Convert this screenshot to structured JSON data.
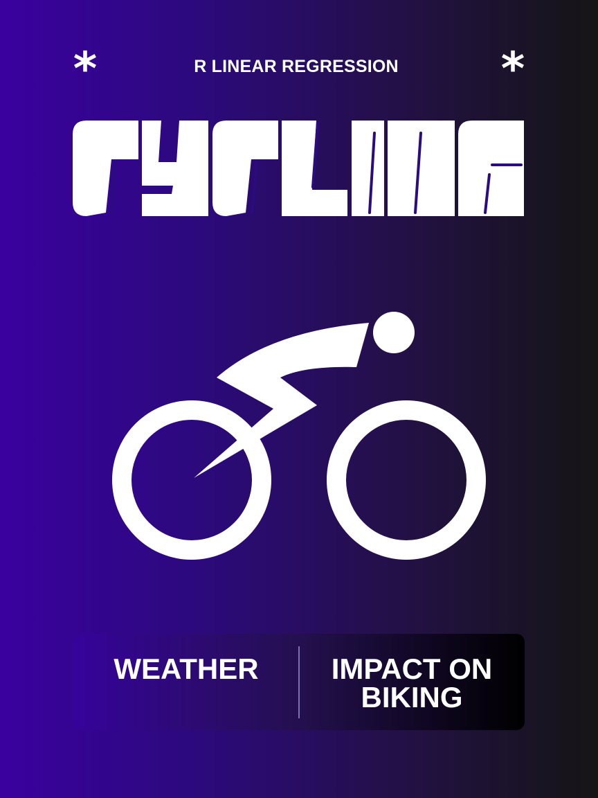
{
  "header": {
    "subtitle": "R LINEAR REGRESSION",
    "asterisk_left": "*",
    "asterisk_right": "*"
  },
  "title": {
    "text": "CYCLING",
    "color": "#ffffff"
  },
  "illustration": {
    "icon": "cyclist-icon",
    "color": "#ffffff"
  },
  "footer": {
    "left_text": "WEATHER",
    "right_line1": "IMPACT ON",
    "right_line2": "BIKING"
  },
  "colors": {
    "background_start": "#3a019f",
    "background_end": "#151515",
    "text": "#ffffff"
  }
}
